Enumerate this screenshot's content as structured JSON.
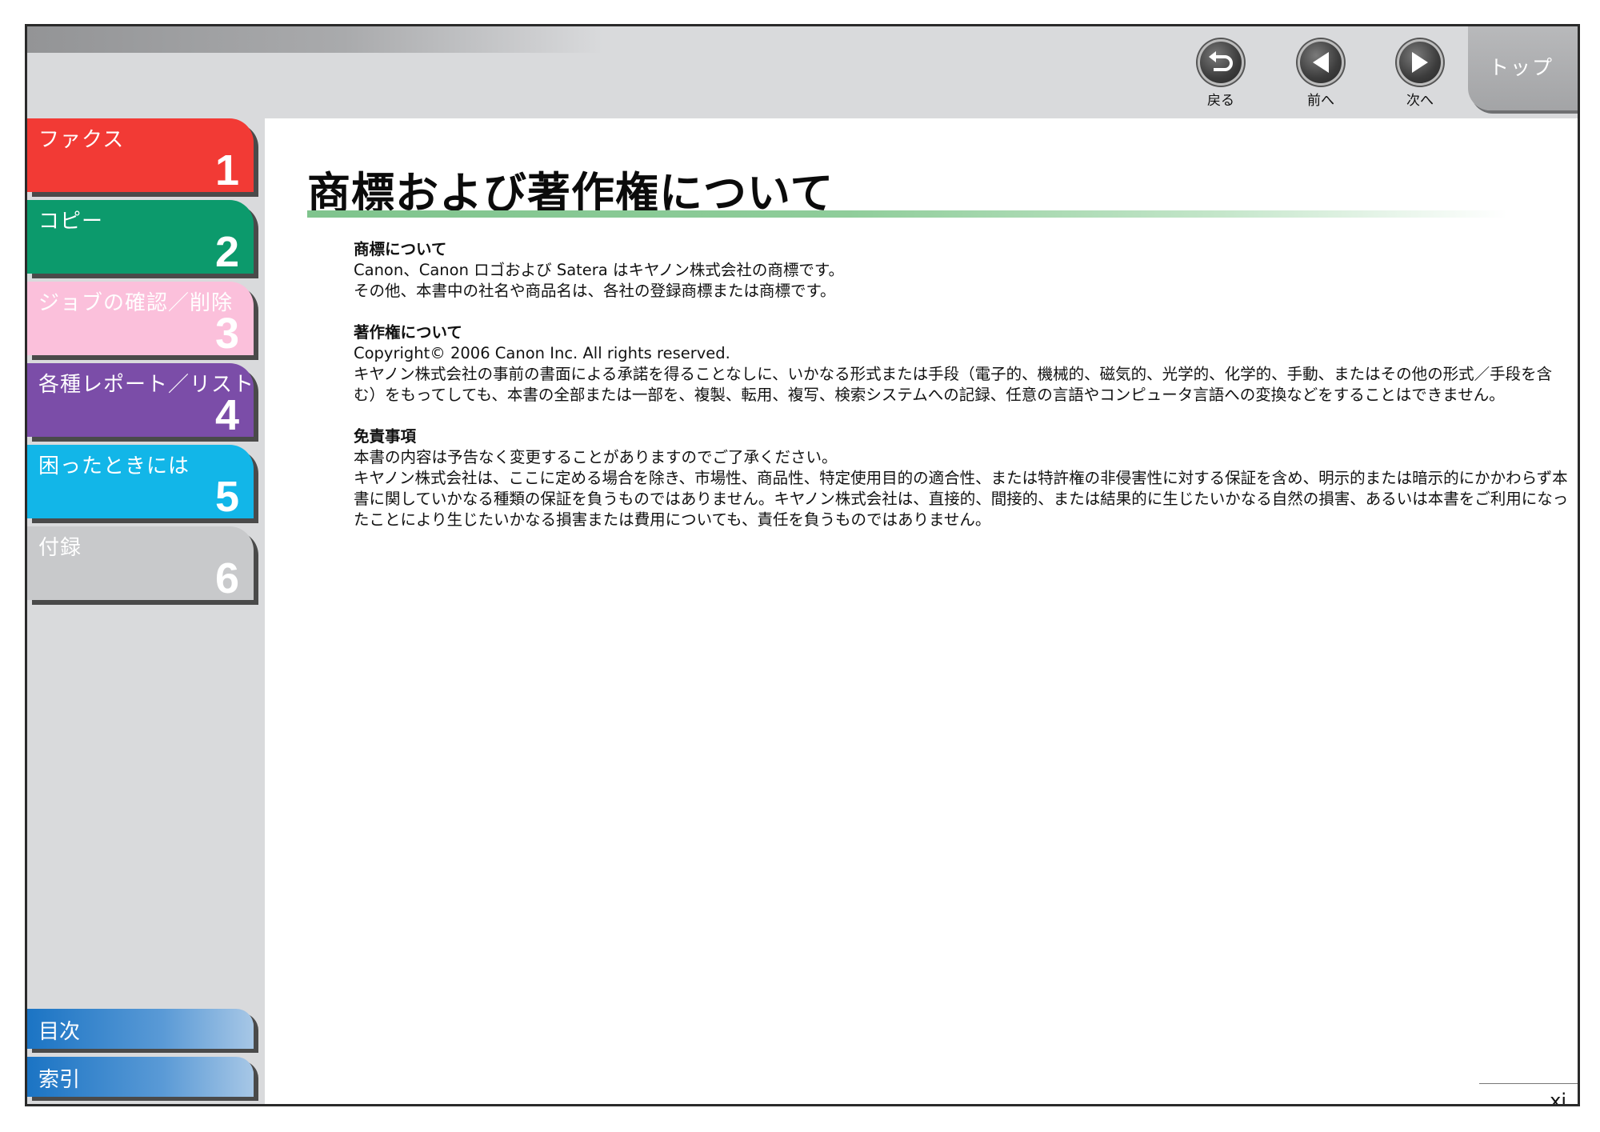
{
  "header": {
    "nav": {
      "back_label": "戻る",
      "prev_label": "前へ",
      "next_label": "次へ"
    },
    "top_label": "トップ"
  },
  "sidebar": {
    "chapters": [
      {
        "label": "ファクス",
        "number": "1",
        "color": "#f23a35"
      },
      {
        "label": "コピー",
        "number": "2",
        "color": "#0c9a6c"
      },
      {
        "label": "ジョブの確認／削除",
        "number": "3",
        "color": "#fbc0db"
      },
      {
        "label": "各種レポート／リスト",
        "number": "4",
        "color": "#7b4da8"
      },
      {
        "label": "困ったときには",
        "number": "5",
        "color": "#12b6e8"
      },
      {
        "label": "付録",
        "number": "6",
        "color": "#c8c9cb"
      }
    ],
    "bottom": {
      "contents_label": "目次",
      "index_label": "索引"
    }
  },
  "main": {
    "title": "商標および著作権について",
    "sections": [
      {
        "heading": "商標について",
        "paragraphs": [
          "Canon、Canon ロゴおよび Satera はキヤノン株式会社の商標です。",
          "その他、本書中の社名や商品名は、各社の登録商標または商標です。"
        ]
      },
      {
        "heading": "著作権について",
        "paragraphs": [
          "Copyright© 2006 Canon Inc. All rights reserved.",
          "キヤノン株式会社の事前の書面による承諾を得ることなしに、いかなる形式または手段（電子的、機械的、磁気的、光学的、化学的、手動、またはその他の形式／手段を含む）をもってしても、本書の全部または一部を、複製、転用、複写、検索システムへの記録、任意の言語やコンピュータ言語への変換などをすることはできません。"
        ]
      },
      {
        "heading": "免責事項",
        "paragraphs": [
          "本書の内容は予告なく変更することがありますのでご了承ください。",
          "キヤノン株式会社は、ここに定める場合を除き、市場性、商品性、特定使用目的の適合性、または特許権の非侵害性に対する保証を含め、明示的または暗示的にかかわらず本書に関していかなる種類の保証を負うものではありません。キヤノン株式会社は、直接的、間接的、または結果的に生じたいかなる自然の損害、あるいは本書をご利用になったことにより生じたいかなる損害または費用についても、責任を負うものではありません。"
        ]
      }
    ],
    "page_number": "xi"
  }
}
